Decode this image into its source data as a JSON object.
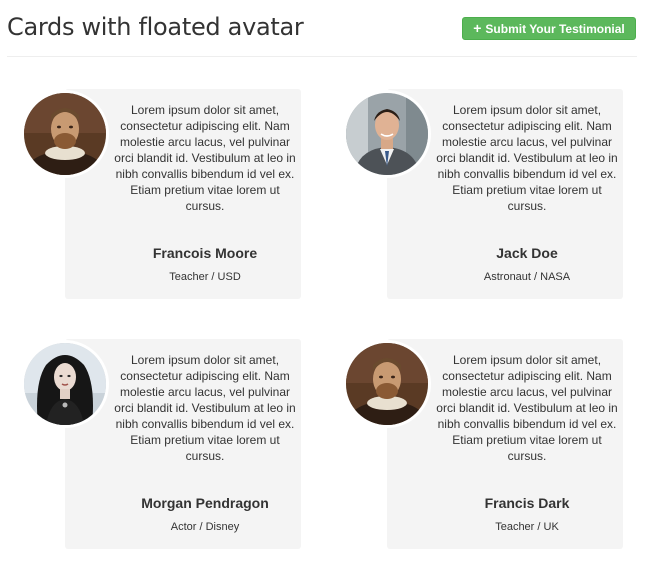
{
  "header": {
    "title": "Cards with floated avatar",
    "submit_button": {
      "icon": "plus-icon",
      "label": "Submit Your Testimonial",
      "color": "#5cb85c"
    }
  },
  "cards": [
    {
      "quote": "Lorem ipsum dolor sit amet, consectetur adipiscing elit. Nam molestie arcu lacus, vel pulvinar orci blandit id. Vestibulum at leo in nibh convallis bibendum id vel ex. Etiam pretium vitae lorem ut cursus.",
      "name": "Francois Moore",
      "role": "Teacher / USD",
      "avatar": "portrait-renaissance-man"
    },
    {
      "quote": "Lorem ipsum dolor sit amet, consectetur adipiscing elit. Nam molestie arcu lacus, vel pulvinar orci blandit id. Vestibulum at leo in nibh convallis bibendum id vel ex. Etiam pretium vitae lorem ut cursus.",
      "name": "Jack Doe",
      "role": "Astronaut / NASA",
      "avatar": "photo-man-in-suit"
    },
    {
      "quote": "Lorem ipsum dolor sit amet, consectetur adipiscing elit. Nam molestie arcu lacus, vel pulvinar orci blandit id. Vestibulum at leo in nibh convallis bibendum id vel ex. Etiam pretium vitae lorem ut cursus.",
      "name": "Morgan Pendragon",
      "role": "Actor / Disney",
      "avatar": "photo-dark-haired-woman"
    },
    {
      "quote": "Lorem ipsum dolor sit amet, consectetur adipiscing elit. Nam molestie arcu lacus, vel pulvinar orci blandit id. Vestibulum at leo in nibh convallis bibendum id vel ex. Etiam pretium vitae lorem ut cursus.",
      "name": "Francis Dark",
      "role": "Teacher / UK",
      "avatar": "portrait-renaissance-man"
    }
  ]
}
